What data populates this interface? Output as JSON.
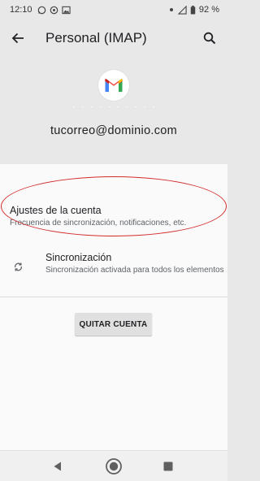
{
  "status_bar": {
    "time": "12:10",
    "battery": "92 %"
  },
  "app_bar": {
    "title": "Personal (IMAP)"
  },
  "account": {
    "email": "tucorreo@dominio.com",
    "avatar_icon": "gmail-logo"
  },
  "settings": [
    {
      "title": "Ajustes de la cuenta",
      "subtitle": "Frecuencia de sincronización, notificaciones, etc."
    },
    {
      "title": "Sincronización",
      "subtitle": "Sincronización activada para todos los elementos",
      "icon": "sync-icon"
    }
  ],
  "actions": {
    "remove_account": "QUITAR CUENTA"
  },
  "colors": {
    "highlight": "#d22b2b",
    "header_bg": "#e8e8e8",
    "content_bg": "#fafafa"
  }
}
